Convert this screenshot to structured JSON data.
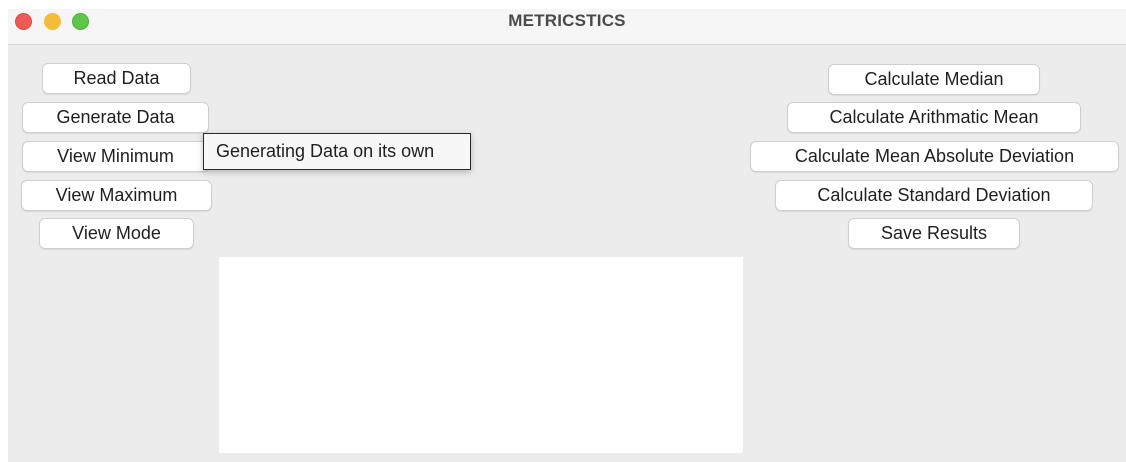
{
  "window": {
    "title": "METRICSTICS"
  },
  "left_buttons": {
    "read_data": "Read Data",
    "generate_data": "Generate Data",
    "view_minimum": "View Minimum",
    "view_maximum": "View Maximum",
    "view_mode": "View Mode"
  },
  "right_buttons": {
    "median": "Calculate Median",
    "arithmetic_mean": "Calculate Arithmatic Mean",
    "mean_absolute_deviation": "Calculate Mean Absolute Deviation",
    "standard_deviation": "Calculate Standard Deviation",
    "save_results": "Save Results"
  },
  "tooltip": {
    "text": "Generating Data on its own"
  },
  "output": {
    "text": ""
  },
  "colors": {
    "close": "#ee5b56",
    "minimize": "#f3bc39",
    "zoom": "#5ec749",
    "window_bg": "#ececec"
  }
}
